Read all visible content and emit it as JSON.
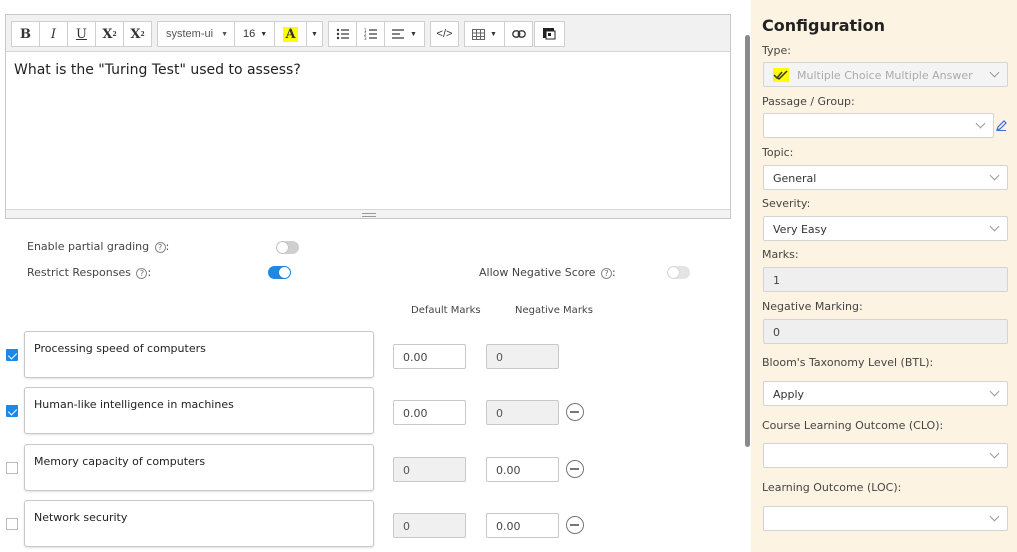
{
  "toolbar": {
    "bold": "B",
    "italic": "I",
    "underline": "U",
    "superscript_base": "X",
    "superscript_mark": "2",
    "subscript_base": "X",
    "subscript_mark": "2",
    "font_family": "system-ui",
    "font_size": "16",
    "highlight_glyph": "A",
    "highlight_color": "#ffff00",
    "code_glyph": "</>"
  },
  "editor": {
    "content": "What is the \"Turing Test\" used to assess?"
  },
  "settings": {
    "partial_grading_label": "Enable partial grading",
    "partial_grading_on": false,
    "restrict_label": "Restrict Responses",
    "restrict_on": true,
    "negative_score_label": "Allow Negative Score",
    "negative_score_on": false,
    "help_glyph": "?"
  },
  "columns": {
    "default_marks": "Default Marks",
    "negative_marks": "Negative Marks"
  },
  "options": [
    {
      "text": "Processing speed of computers",
      "checked": true,
      "default_marks": "0.00",
      "negative_marks": "0",
      "removable": false
    },
    {
      "text": "Human-like intelligence in machines",
      "checked": true,
      "default_marks": "0.00",
      "negative_marks": "0",
      "removable": true
    },
    {
      "text": "Memory capacity of computers",
      "checked": false,
      "default_marks": "0",
      "negative_marks": "0.00",
      "removable": true
    },
    {
      "text": "Network security",
      "checked": false,
      "default_marks": "0",
      "negative_marks": "0.00",
      "removable": true
    }
  ],
  "config": {
    "title": "Configuration",
    "type_label": "Type:",
    "type_value": "Multiple Choice Multiple Answer",
    "passage_label": "Passage / Group:",
    "passage_value": "",
    "topic_label": "Topic:",
    "topic_value": "General",
    "severity_label": "Severity:",
    "severity_value": "Very Easy",
    "marks_label": "Marks:",
    "marks_value": "1",
    "negative_marking_label": "Negative Marking:",
    "negative_marking_value": "0",
    "btl_label": "Bloom's Taxonomy Level (BTL):",
    "btl_value": "Apply",
    "clo_label": "Course Learning Outcome (CLO):",
    "clo_value": "",
    "loc_label": "Learning Outcome (LOC):",
    "loc_value": ""
  },
  "colors": {
    "accent": "#1e88e5",
    "panel_bg": "#fdf3e2",
    "type_icon_bg": "#ffff00"
  }
}
